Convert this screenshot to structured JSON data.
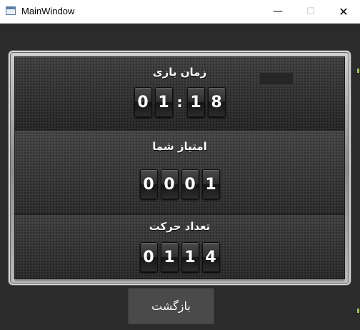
{
  "window": {
    "title": "MainWindow"
  },
  "window_controls": {
    "minimize": "—",
    "maximize": "☐",
    "close": "✕"
  },
  "time_section": {
    "label": "زمان بازی",
    "digits": [
      "0",
      "1",
      "1",
      "8"
    ],
    "separator": ":"
  },
  "score_section": {
    "label": "امتیاز شما",
    "digits": [
      "0",
      "0",
      "0",
      "1"
    ]
  },
  "moves_section": {
    "label": "تعداد حرکت",
    "digits": [
      "0",
      "1",
      "1",
      "4"
    ]
  },
  "back_button": {
    "label": "بازگشت"
  },
  "colors": {
    "window_bg": "#2b2b2b",
    "panel_inner": "#3a3a3a",
    "digit_text": "#ffffff",
    "button_bg": "#4a4a4a",
    "edge_accent_green": "#9acd32",
    "edge_accent_pink": "#e0609a"
  }
}
